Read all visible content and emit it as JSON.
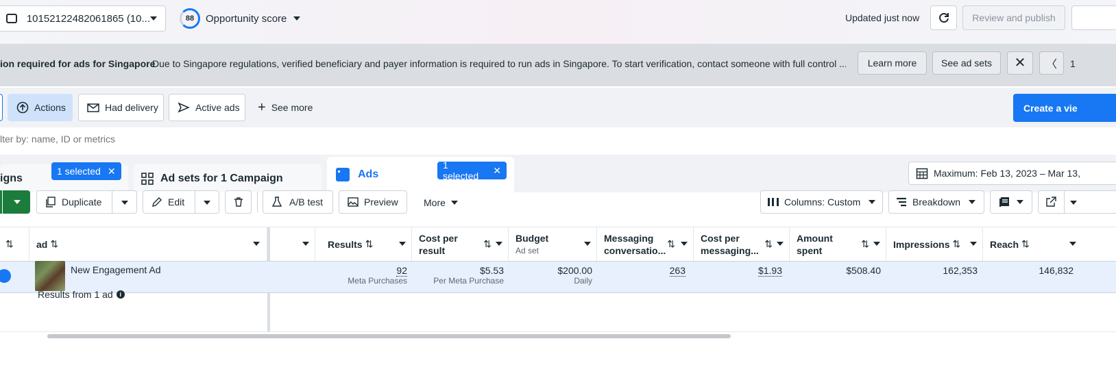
{
  "account": {
    "id_label": "10152122482061865 (10..."
  },
  "opportunity": {
    "score": "88",
    "label": "Opportunity score"
  },
  "status": {
    "updated": "Updated just now"
  },
  "publish": {
    "label": "Review and publish"
  },
  "banner": {
    "title": "ion required for ads for Singapore",
    "message": "Due to Singapore regulations, verified beneficiary and payer information is required to run ads in Singapore. To start verification, contact someone with full control ...",
    "learn_more": "Learn more",
    "see_ad_sets": "See ad sets",
    "page": "1"
  },
  "filters": {
    "actions": "Actions",
    "had_delivery": "Had delivery",
    "active_ads": "Active ads",
    "see_more": "See more",
    "create_view": "Create a vie"
  },
  "search": {
    "placeholder": "lter by: name, ID or metrics"
  },
  "tabs": {
    "campaigns": {
      "label": "igns",
      "selected": "1 selected"
    },
    "adsets": {
      "label": "Ad sets for 1 Campaign"
    },
    "ads": {
      "label": "Ads",
      "selected": "1 selected"
    },
    "date_range": "Maximum: Feb 13, 2023 – Mar 13,"
  },
  "toolbar": {
    "duplicate": "Duplicate",
    "edit": "Edit",
    "ab_test": "A/B test",
    "preview": "Preview",
    "more": "More",
    "columns": "Columns: Custom",
    "breakdown": "Breakdown"
  },
  "table": {
    "headers": {
      "ad": "ad",
      "results": "Results",
      "cost_per_result": [
        "Cost per",
        "result"
      ],
      "budget": "Budget",
      "budget_sub": "Ad set",
      "messaging": [
        "Messaging",
        "conversatio..."
      ],
      "cost_per_messaging": [
        "Cost per",
        "messaging..."
      ],
      "amount_spent": [
        "Amount",
        "spent"
      ],
      "impressions": "Impressions",
      "reach": "Reach"
    },
    "row": {
      "name": "New Engagement Ad",
      "results": "92",
      "results_sub": "Meta Purchases",
      "cost_per_result": "$5.53",
      "cost_per_result_sub": "Per Meta Purchase",
      "budget": "$200.00",
      "budget_sub": "Daily",
      "messaging": "263",
      "cost_per_messaging": "$1.93",
      "amount_spent": "$508.40",
      "impressions": "162,353",
      "reach": "146,832"
    },
    "footer": "Results from 1 ad"
  },
  "colors": {
    "accent": "#1877f2",
    "green": "#1c7c3c",
    "banner": "#dadde1"
  }
}
